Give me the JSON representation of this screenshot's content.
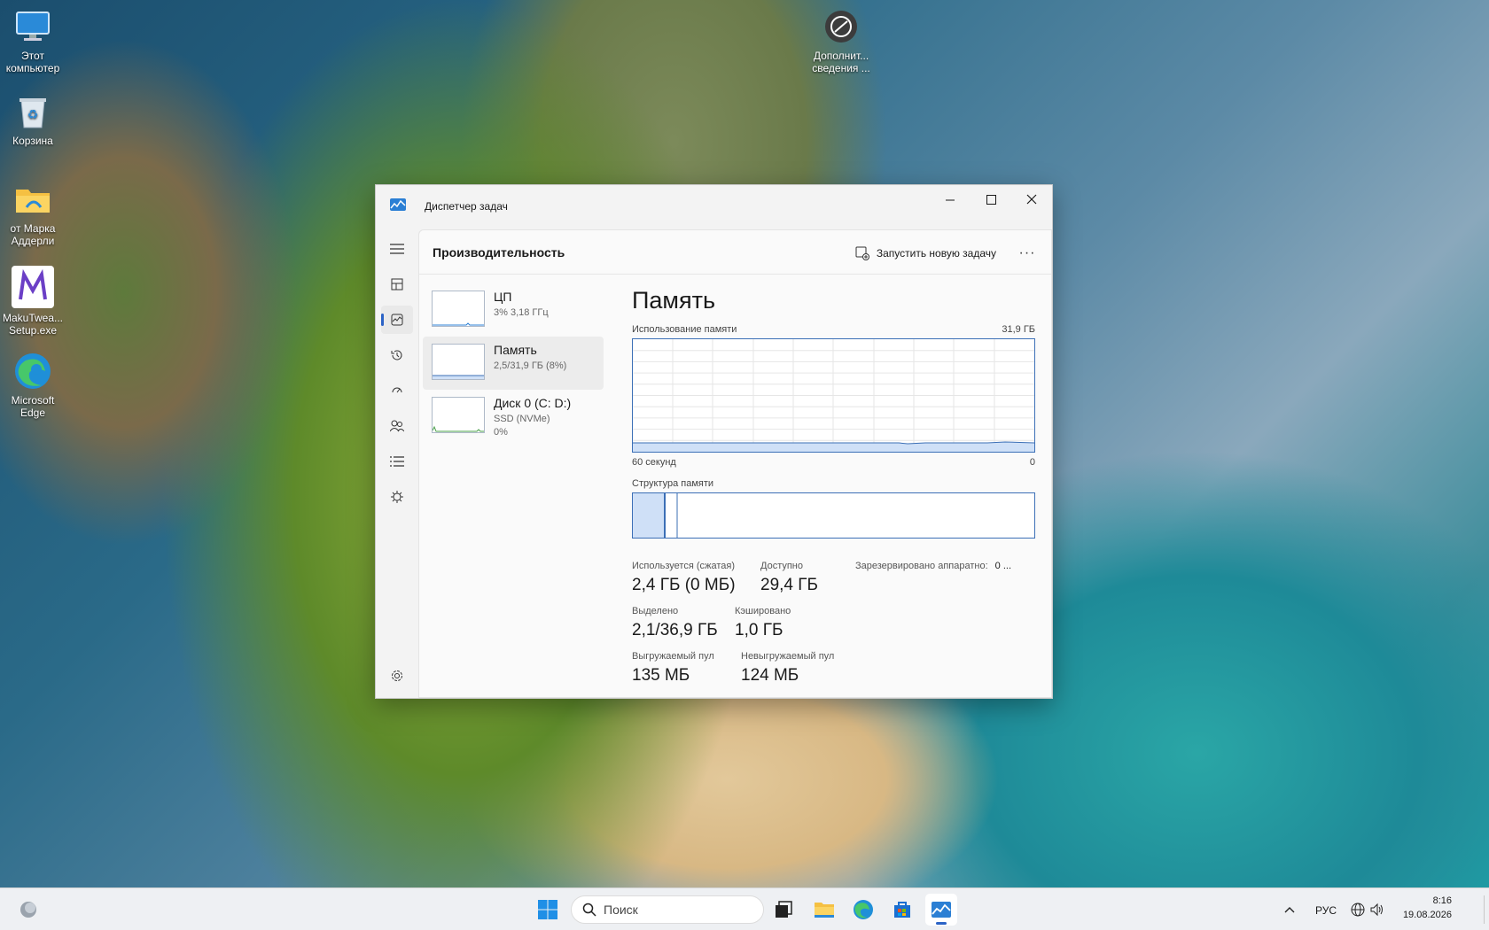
{
  "desktop": {
    "icons": [
      {
        "label": "Этот компьютер",
        "icon": "monitor-icon"
      },
      {
        "label": "Корзина",
        "icon": "recycle-bin-icon"
      },
      {
        "label": "от Марка Аддерли",
        "icon": "folder-icon"
      },
      {
        "label": "MakuTwea... Setup.exe",
        "icon": "app-icon"
      },
      {
        "label": "Microsoft Edge",
        "icon": "edge-icon"
      },
      {
        "label": "Дополнит... сведения ...",
        "icon": "info-icon"
      }
    ]
  },
  "window": {
    "title": "Диспетчер задач",
    "header": "Производительность",
    "run_task_label": "Запустить новую задачу",
    "more_label": "···",
    "perf_items": [
      {
        "name": "ЦП",
        "sub1": "3% 3,18 ГГц",
        "sub2": ""
      },
      {
        "name": "Память",
        "sub1": "2,5/31,9 ГБ (8%)",
        "sub2": ""
      },
      {
        "name": "Диск 0 (C: D:)",
        "sub1": "SSD (NVMe)",
        "sub2": "0%"
      }
    ],
    "detail": {
      "title": "Память",
      "usage_label": "Использование памяти",
      "usage_max": "31,9 ГБ",
      "time_left": "60 секунд",
      "time_right": "0",
      "structure_label": "Структура памяти",
      "stats": {
        "in_use_label": "Используется (сжатая)",
        "in_use_value": "2,4 ГБ (0 МБ)",
        "available_label": "Доступно",
        "available_value": "29,4 ГБ",
        "reserved_label": "Зарезервировано аппаратно:",
        "reserved_value": "0 ...",
        "committed_label": "Выделено",
        "committed_value": "2,1/36,9 ГБ",
        "cached_label": "Кэшировано",
        "cached_value": "1,0 ГБ",
        "paged_label": "Выгружаемый пул",
        "paged_value": "135 МБ",
        "nonpaged_label": "Невыгружаемый пул",
        "nonpaged_value": "124 МБ"
      }
    }
  },
  "taskbar": {
    "search_placeholder": "Поиск",
    "language": "РУС",
    "time": "8:16",
    "date": "19.08.2026"
  },
  "colors": {
    "accent": "#2b63c6",
    "graph_border": "#3b6fb6",
    "graph_fill": "#cfe0f7"
  }
}
